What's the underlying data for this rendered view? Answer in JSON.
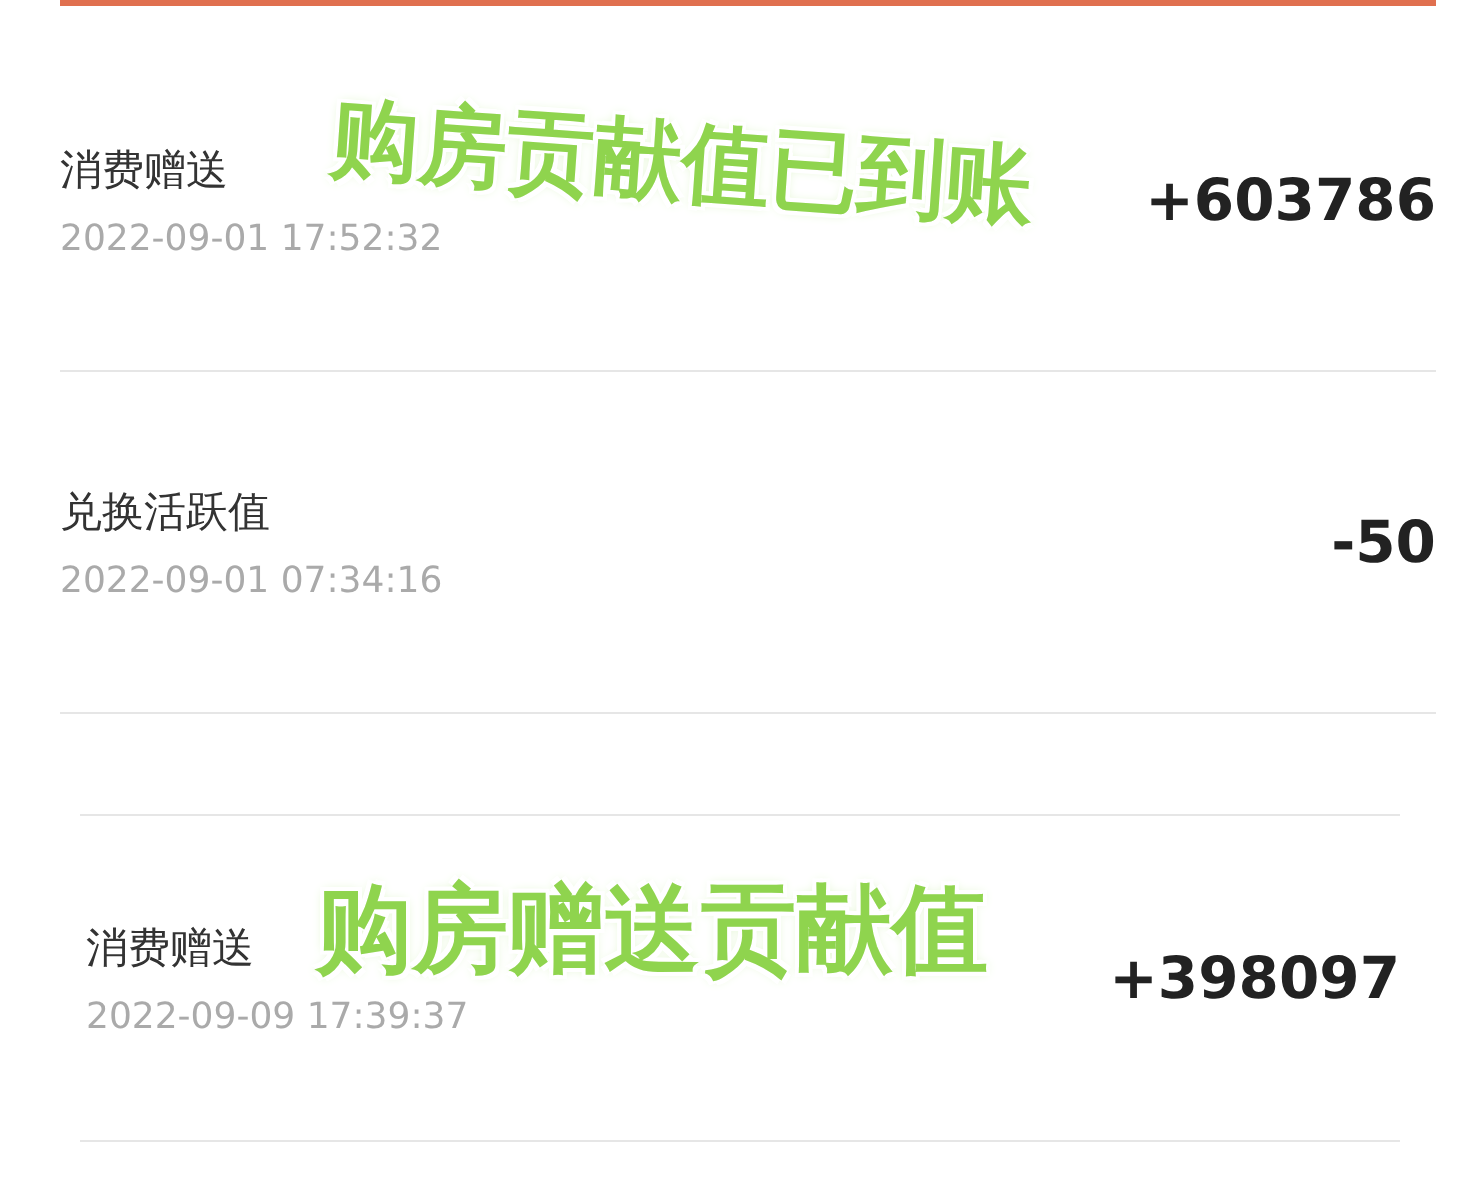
{
  "panels": [
    {
      "records": [
        {
          "title": "消费赠送",
          "time": "2022-09-01 17:52:32",
          "amount": "+603786",
          "annotation": "购房贡献值已到账"
        },
        {
          "title": "兑换活跃值",
          "time": "2022-09-01 07:34:16",
          "amount": "-50"
        }
      ]
    },
    {
      "records": [
        {
          "title": "消费赠送",
          "time": "2022-09-09 17:39:37",
          "amount": "+398097",
          "annotation": "购房赠送贡献值"
        }
      ]
    }
  ]
}
